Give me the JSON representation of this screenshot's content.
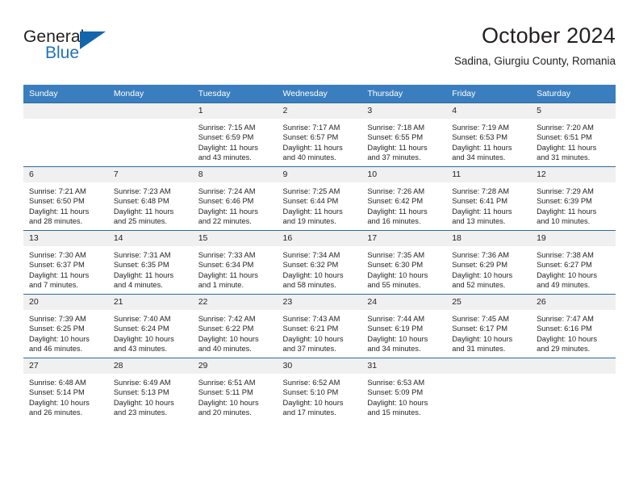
{
  "logo": {
    "general": "General",
    "blue": "Blue",
    "triangle_color": "#1366ab"
  },
  "header": {
    "title": "October 2024",
    "location": "Sadina, Giurgiu County, Romania"
  },
  "theme": {
    "header_blue": "#3a7ebf",
    "border_blue": "#2b6ca3",
    "daynum_gray": "#f0f0f0",
    "text": "#231f20"
  },
  "weekday_headers": [
    "Sunday",
    "Monday",
    "Tuesday",
    "Wednesday",
    "Thursday",
    "Friday",
    "Saturday"
  ],
  "weeks": [
    [
      {
        "day": "",
        "sunrise": "",
        "sunset": "",
        "daylight1": "",
        "daylight2": ""
      },
      {
        "day": "",
        "sunrise": "",
        "sunset": "",
        "daylight1": "",
        "daylight2": ""
      },
      {
        "day": "1",
        "sunrise": "Sunrise: 7:15 AM",
        "sunset": "Sunset: 6:59 PM",
        "daylight1": "Daylight: 11 hours",
        "daylight2": "and 43 minutes."
      },
      {
        "day": "2",
        "sunrise": "Sunrise: 7:17 AM",
        "sunset": "Sunset: 6:57 PM",
        "daylight1": "Daylight: 11 hours",
        "daylight2": "and 40 minutes."
      },
      {
        "day": "3",
        "sunrise": "Sunrise: 7:18 AM",
        "sunset": "Sunset: 6:55 PM",
        "daylight1": "Daylight: 11 hours",
        "daylight2": "and 37 minutes."
      },
      {
        "day": "4",
        "sunrise": "Sunrise: 7:19 AM",
        "sunset": "Sunset: 6:53 PM",
        "daylight1": "Daylight: 11 hours",
        "daylight2": "and 34 minutes."
      },
      {
        "day": "5",
        "sunrise": "Sunrise: 7:20 AM",
        "sunset": "Sunset: 6:51 PM",
        "daylight1": "Daylight: 11 hours",
        "daylight2": "and 31 minutes."
      }
    ],
    [
      {
        "day": "6",
        "sunrise": "Sunrise: 7:21 AM",
        "sunset": "Sunset: 6:50 PM",
        "daylight1": "Daylight: 11 hours",
        "daylight2": "and 28 minutes."
      },
      {
        "day": "7",
        "sunrise": "Sunrise: 7:23 AM",
        "sunset": "Sunset: 6:48 PM",
        "daylight1": "Daylight: 11 hours",
        "daylight2": "and 25 minutes."
      },
      {
        "day": "8",
        "sunrise": "Sunrise: 7:24 AM",
        "sunset": "Sunset: 6:46 PM",
        "daylight1": "Daylight: 11 hours",
        "daylight2": "and 22 minutes."
      },
      {
        "day": "9",
        "sunrise": "Sunrise: 7:25 AM",
        "sunset": "Sunset: 6:44 PM",
        "daylight1": "Daylight: 11 hours",
        "daylight2": "and 19 minutes."
      },
      {
        "day": "10",
        "sunrise": "Sunrise: 7:26 AM",
        "sunset": "Sunset: 6:42 PM",
        "daylight1": "Daylight: 11 hours",
        "daylight2": "and 16 minutes."
      },
      {
        "day": "11",
        "sunrise": "Sunrise: 7:28 AM",
        "sunset": "Sunset: 6:41 PM",
        "daylight1": "Daylight: 11 hours",
        "daylight2": "and 13 minutes."
      },
      {
        "day": "12",
        "sunrise": "Sunrise: 7:29 AM",
        "sunset": "Sunset: 6:39 PM",
        "daylight1": "Daylight: 11 hours",
        "daylight2": "and 10 minutes."
      }
    ],
    [
      {
        "day": "13",
        "sunrise": "Sunrise: 7:30 AM",
        "sunset": "Sunset: 6:37 PM",
        "daylight1": "Daylight: 11 hours",
        "daylight2": "and 7 minutes."
      },
      {
        "day": "14",
        "sunrise": "Sunrise: 7:31 AM",
        "sunset": "Sunset: 6:35 PM",
        "daylight1": "Daylight: 11 hours",
        "daylight2": "and 4 minutes."
      },
      {
        "day": "15",
        "sunrise": "Sunrise: 7:33 AM",
        "sunset": "Sunset: 6:34 PM",
        "daylight1": "Daylight: 11 hours",
        "daylight2": "and 1 minute."
      },
      {
        "day": "16",
        "sunrise": "Sunrise: 7:34 AM",
        "sunset": "Sunset: 6:32 PM",
        "daylight1": "Daylight: 10 hours",
        "daylight2": "and 58 minutes."
      },
      {
        "day": "17",
        "sunrise": "Sunrise: 7:35 AM",
        "sunset": "Sunset: 6:30 PM",
        "daylight1": "Daylight: 10 hours",
        "daylight2": "and 55 minutes."
      },
      {
        "day": "18",
        "sunrise": "Sunrise: 7:36 AM",
        "sunset": "Sunset: 6:29 PM",
        "daylight1": "Daylight: 10 hours",
        "daylight2": "and 52 minutes."
      },
      {
        "day": "19",
        "sunrise": "Sunrise: 7:38 AM",
        "sunset": "Sunset: 6:27 PM",
        "daylight1": "Daylight: 10 hours",
        "daylight2": "and 49 minutes."
      }
    ],
    [
      {
        "day": "20",
        "sunrise": "Sunrise: 7:39 AM",
        "sunset": "Sunset: 6:25 PM",
        "daylight1": "Daylight: 10 hours",
        "daylight2": "and 46 minutes."
      },
      {
        "day": "21",
        "sunrise": "Sunrise: 7:40 AM",
        "sunset": "Sunset: 6:24 PM",
        "daylight1": "Daylight: 10 hours",
        "daylight2": "and 43 minutes."
      },
      {
        "day": "22",
        "sunrise": "Sunrise: 7:42 AM",
        "sunset": "Sunset: 6:22 PM",
        "daylight1": "Daylight: 10 hours",
        "daylight2": "and 40 minutes."
      },
      {
        "day": "23",
        "sunrise": "Sunrise: 7:43 AM",
        "sunset": "Sunset: 6:21 PM",
        "daylight1": "Daylight: 10 hours",
        "daylight2": "and 37 minutes."
      },
      {
        "day": "24",
        "sunrise": "Sunrise: 7:44 AM",
        "sunset": "Sunset: 6:19 PM",
        "daylight1": "Daylight: 10 hours",
        "daylight2": "and 34 minutes."
      },
      {
        "day": "25",
        "sunrise": "Sunrise: 7:45 AM",
        "sunset": "Sunset: 6:17 PM",
        "daylight1": "Daylight: 10 hours",
        "daylight2": "and 31 minutes."
      },
      {
        "day": "26",
        "sunrise": "Sunrise: 7:47 AM",
        "sunset": "Sunset: 6:16 PM",
        "daylight1": "Daylight: 10 hours",
        "daylight2": "and 29 minutes."
      }
    ],
    [
      {
        "day": "27",
        "sunrise": "Sunrise: 6:48 AM",
        "sunset": "Sunset: 5:14 PM",
        "daylight1": "Daylight: 10 hours",
        "daylight2": "and 26 minutes."
      },
      {
        "day": "28",
        "sunrise": "Sunrise: 6:49 AM",
        "sunset": "Sunset: 5:13 PM",
        "daylight1": "Daylight: 10 hours",
        "daylight2": "and 23 minutes."
      },
      {
        "day": "29",
        "sunrise": "Sunrise: 6:51 AM",
        "sunset": "Sunset: 5:11 PM",
        "daylight1": "Daylight: 10 hours",
        "daylight2": "and 20 minutes."
      },
      {
        "day": "30",
        "sunrise": "Sunrise: 6:52 AM",
        "sunset": "Sunset: 5:10 PM",
        "daylight1": "Daylight: 10 hours",
        "daylight2": "and 17 minutes."
      },
      {
        "day": "31",
        "sunrise": "Sunrise: 6:53 AM",
        "sunset": "Sunset: 5:09 PM",
        "daylight1": "Daylight: 10 hours",
        "daylight2": "and 15 minutes."
      },
      {
        "day": "",
        "sunrise": "",
        "sunset": "",
        "daylight1": "",
        "daylight2": ""
      },
      {
        "day": "",
        "sunrise": "",
        "sunset": "",
        "daylight1": "",
        "daylight2": ""
      }
    ]
  ]
}
